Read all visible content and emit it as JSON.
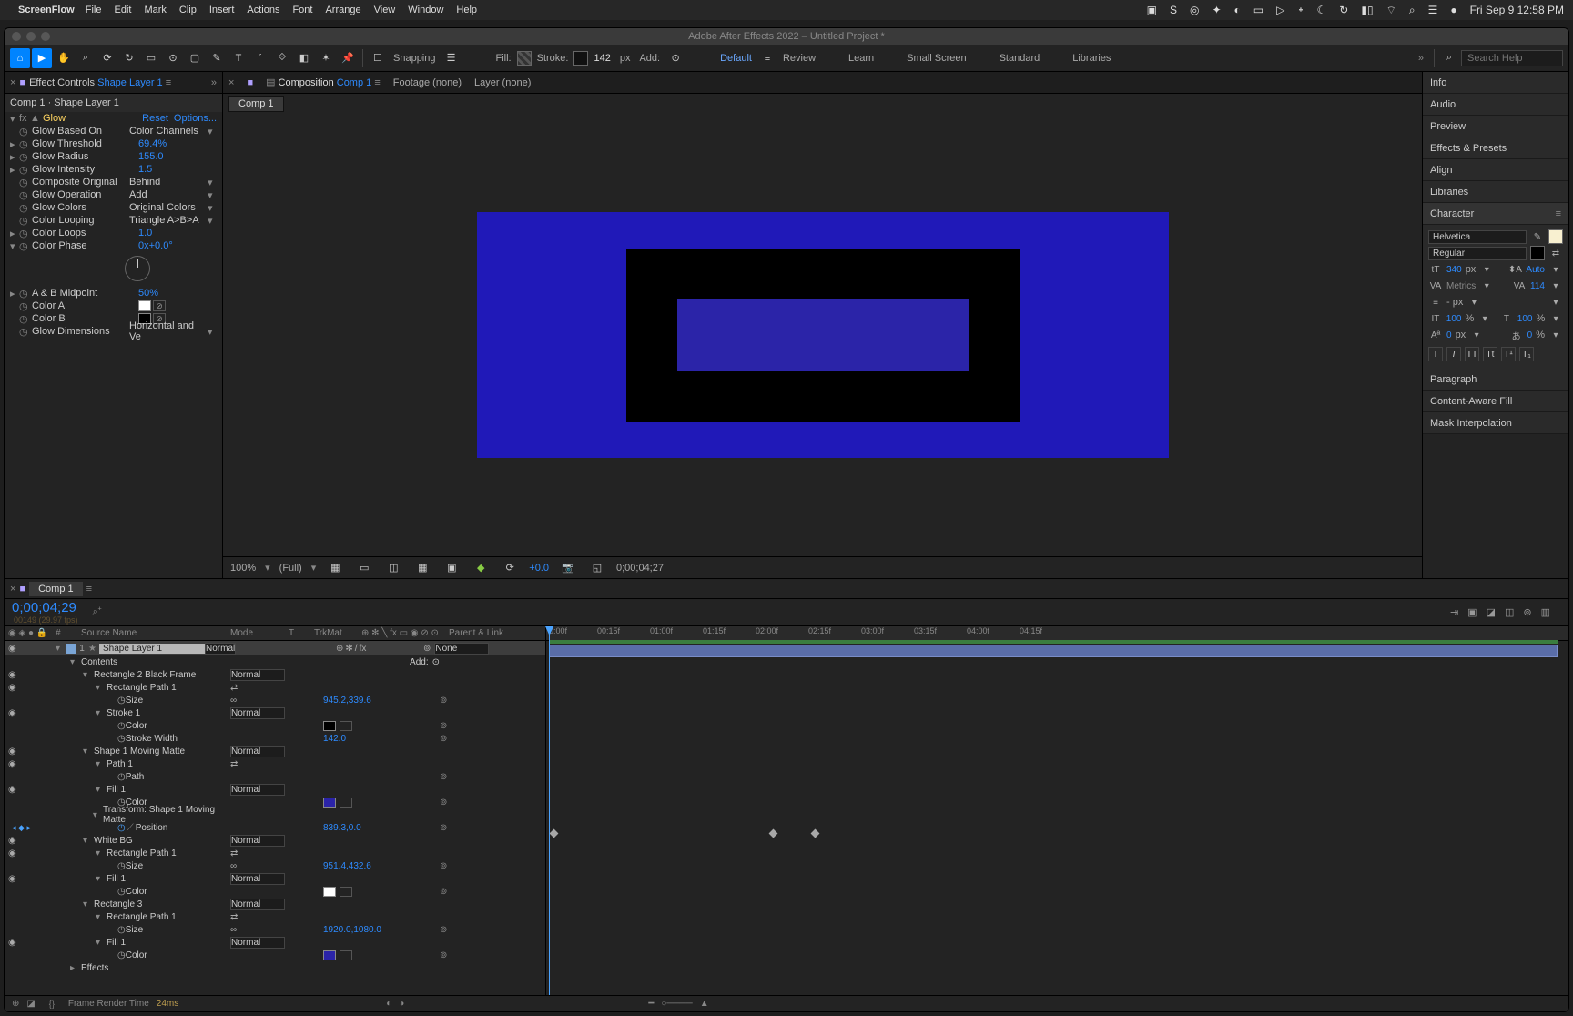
{
  "menubar": {
    "app": "ScreenFlow",
    "items": [
      "File",
      "Edit",
      "Mark",
      "Clip",
      "Insert",
      "Actions",
      "Font",
      "Arrange",
      "View",
      "Window",
      "Help"
    ],
    "clock": "Fri Sep 9  12:58 PM"
  },
  "window": {
    "title": "Adobe After Effects 2022 – Untitled Project *"
  },
  "toolbar": {
    "snapping": "Snapping",
    "fill_label": "Fill:",
    "stroke_label": "Stroke:",
    "stroke_width": "142",
    "stroke_unit": "px",
    "add_label": "Add:",
    "workspaces": [
      "Default",
      "Review",
      "Learn",
      "Small Screen",
      "Standard",
      "Libraries"
    ],
    "search_placeholder": "Search Help"
  },
  "ec": {
    "tab_prefix": "Effect Controls",
    "tab_layer": "Shape Layer 1",
    "header": "Comp 1 · Shape Layer 1",
    "glow": "Glow",
    "reset": "Reset",
    "options": "Options...",
    "rows": {
      "based": {
        "n": "Glow Based On",
        "v": "Color Channels"
      },
      "thresh": {
        "n": "Glow Threshold",
        "v": "69.4%"
      },
      "radius": {
        "n": "Glow Radius",
        "v": "155.0"
      },
      "intensity": {
        "n": "Glow Intensity",
        "v": "1.5"
      },
      "compOrig": {
        "n": "Composite Original",
        "v": "Behind"
      },
      "op": {
        "n": "Glow Operation",
        "v": "Add"
      },
      "colors": {
        "n": "Glow Colors",
        "v": "Original Colors"
      },
      "loop": {
        "n": "Color Looping",
        "v": "Triangle A>B>A"
      },
      "loops": {
        "n": "Color Loops",
        "v": "1.0"
      },
      "phase": {
        "n": "Color Phase",
        "v": "0x+0.0°"
      },
      "abmid": {
        "n": "A & B Midpoint",
        "v": "50%"
      },
      "colA": {
        "n": "Color A"
      },
      "colB": {
        "n": "Color B"
      },
      "dim": {
        "n": "Glow Dimensions",
        "v": "Horizontal and Ve"
      }
    }
  },
  "center": {
    "tabs": {
      "comp_prefix": "Composition",
      "comp_name": "Comp 1",
      "footage": "Footage (none)",
      "layer": "Layer (none)"
    },
    "subtab": "Comp 1",
    "footer": {
      "zoom": "100%",
      "res": "(Full)",
      "exp": "+0.0",
      "tc": "0;00;04;27"
    }
  },
  "right": {
    "items": [
      "Info",
      "Audio",
      "Preview",
      "Effects & Presets",
      "Align",
      "Libraries"
    ],
    "character": {
      "title": "Character",
      "font": "Helvetica",
      "style": "Regular",
      "size": "340",
      "size_unit": "px",
      "leading": "Auto",
      "kern": "Metrics",
      "track": "114",
      "px_dash": "- px",
      "vscale": "100",
      "hscale": "100",
      "baseline": "0",
      "baseline_unit": "px",
      "stroke_pct": "0",
      "pct": "%"
    },
    "items2": [
      "Paragraph",
      "Content-Aware Fill",
      "Mask Interpolation"
    ]
  },
  "timeline": {
    "tab": "Comp 1",
    "tc": "0;00;04;29",
    "tc_sub": "00149 (29.97 fps)",
    "ruler": [
      "0:00f",
      "00:15f",
      "01:00f",
      "01:15f",
      "02:00f",
      "02:15f",
      "03:00f",
      "03:15f",
      "04:00f",
      "04:15f"
    ],
    "cols": {
      "num": "#",
      "src": "Source Name",
      "mode": "Mode",
      "t": "T",
      "trk": "TrkMat",
      "par": "Parent & Link"
    },
    "layer": {
      "num": "1",
      "name": "Shape Layer 1",
      "mode": "Normal",
      "parent": "None",
      "add": "Add:"
    },
    "props": {
      "contents": "Contents",
      "rect2": "Rectangle 2 Black Frame",
      "rectPath1": "Rectangle Path 1",
      "size": "Size",
      "sizeVal1": "945.2,339.6",
      "stroke1": "Stroke 1",
      "color": "Color",
      "strokeWidth": "Stroke Width",
      "strokeWVal": "142.0",
      "shape1": "Shape 1 Moving Matte",
      "path1": "Path 1",
      "path": "Path",
      "fill1": "Fill 1",
      "transform": "Transform: Shape 1 Moving Matte",
      "position": "Position",
      "posVal": "839.3,0.0",
      "whitebg": "White BG",
      "sizeVal2": "951.4,432.6",
      "rect3": "Rectangle 3",
      "sizeVal3": "1920.0,1080.0",
      "effects": "Effects",
      "normal": "Normal"
    },
    "footer": {
      "label": "Frame Render Time",
      "ms": "24ms"
    }
  }
}
